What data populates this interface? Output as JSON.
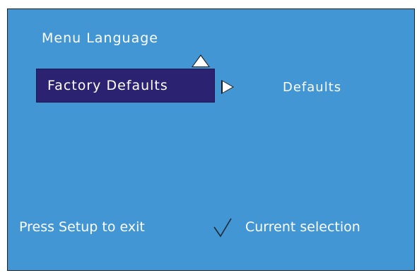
{
  "menu": {
    "title": "Menu Language",
    "selected_item": "Factory Defaults",
    "selected_value": "Defaults"
  },
  "footer": {
    "exit_hint": "Press Setup to exit",
    "legend_label": "Current selection"
  },
  "icons": {
    "up": "up-arrow-icon",
    "right": "right-arrow-icon",
    "check": "checkmark-icon"
  },
  "colors": {
    "background": "#4196d3",
    "highlight": "#2b2271",
    "text": "#ffffff"
  }
}
